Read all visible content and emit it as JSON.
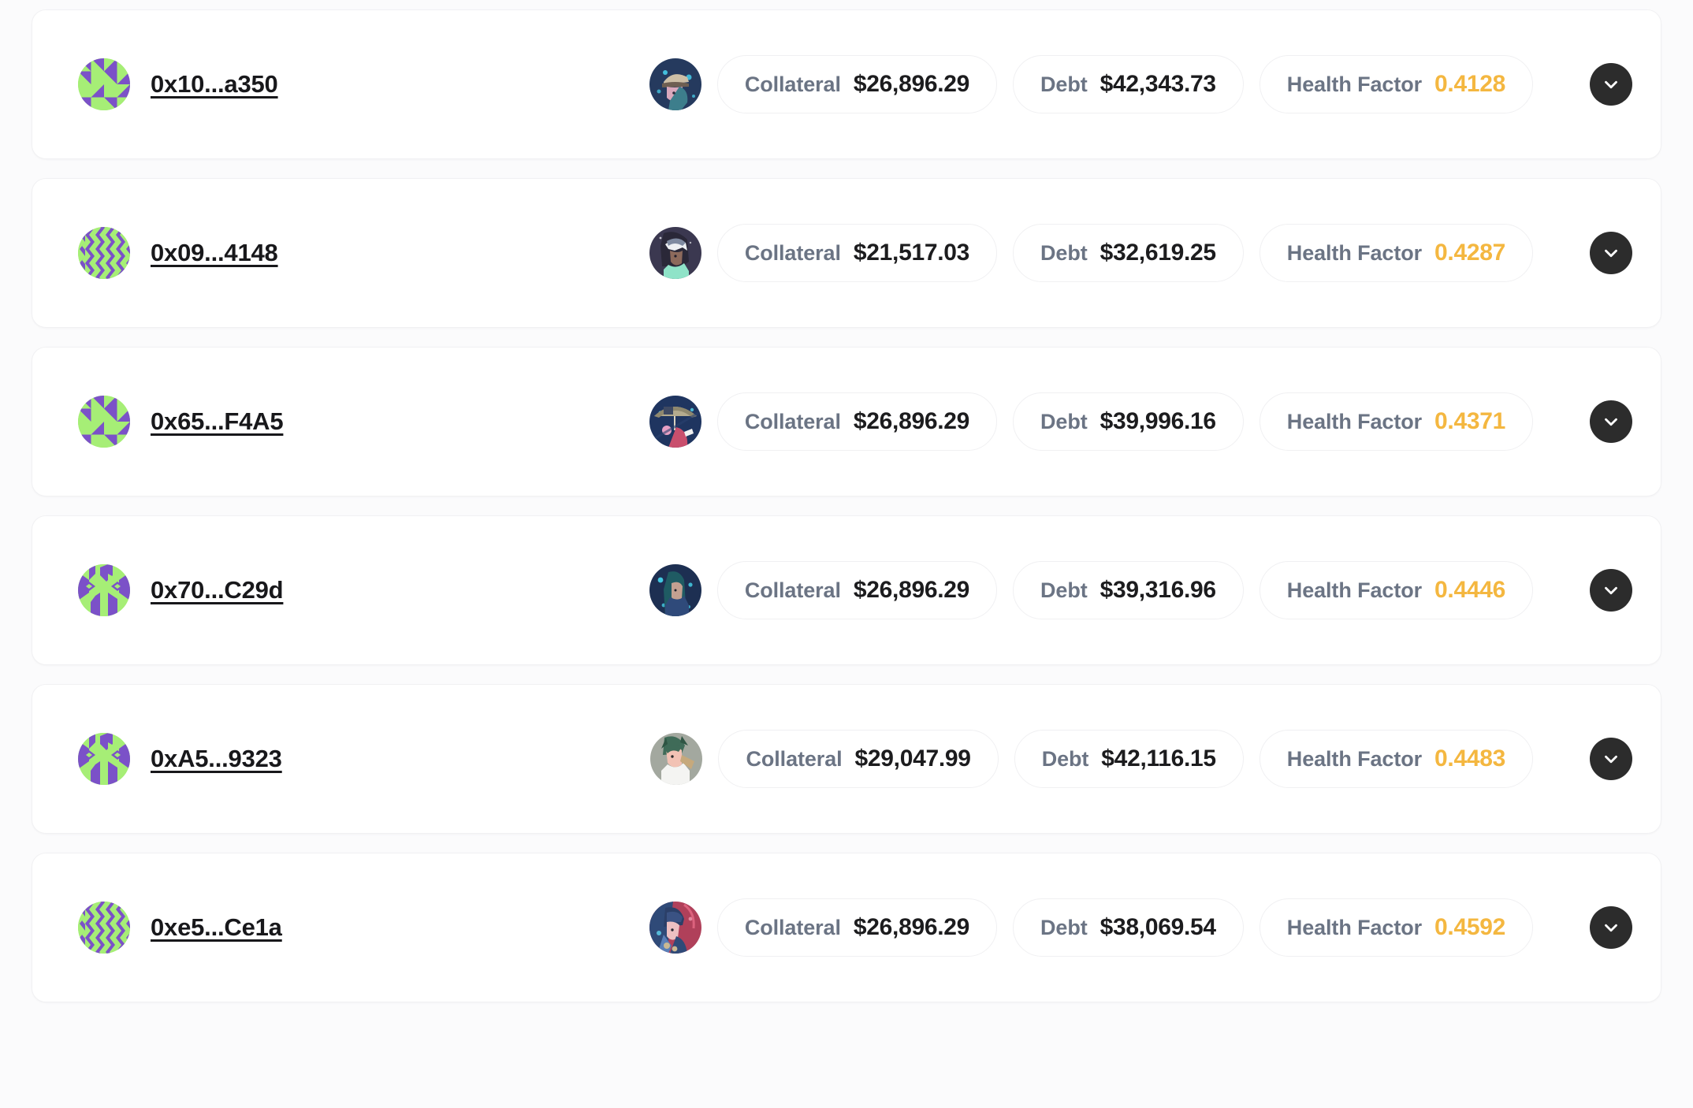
{
  "list": {
    "name": "liquidation-positions-list",
    "labels": {
      "collateral": "Collateral",
      "debt": "Debt",
      "health_factor": "Health Factor"
    },
    "colors": {
      "health_factor_value": "#f4b740",
      "metric_label": "#6b7484",
      "metric_value": "#1c1c1e",
      "expand_button_bg": "#2c2c2c",
      "card_bg": "#ffffff",
      "page_bg": "#fbfbfc",
      "identicon_purple": "#7b51c8",
      "identicon_green": "#a6ee76"
    },
    "icons": {
      "expand": "chevron-down-icon"
    },
    "rows": [
      {
        "address": "0x10...a350",
        "identicon_pattern": "triangles",
        "avatar": "anime-avatar-cap-blue",
        "collateral_label": "Collateral",
        "collateral": "$26,896.29",
        "debt_label": "Debt",
        "debt": "$42,343.73",
        "health_label": "Health Factor",
        "health_factor": "0.4128"
      },
      {
        "address": "0x09...4148",
        "identicon_pattern": "herringbone",
        "avatar": "anime-avatar-white-hair",
        "collateral_label": "Collateral",
        "collateral": "$21,517.03",
        "debt_label": "Debt",
        "debt": "$32,619.25",
        "health_label": "Health Factor",
        "health_factor": "0.4287"
      },
      {
        "address": "0x65...F4A5",
        "identicon_pattern": "triangles",
        "avatar": "anime-avatar-umbrella",
        "collateral_label": "Collateral",
        "collateral": "$26,896.29",
        "debt_label": "Debt",
        "debt": "$39,996.16",
        "health_label": "Health Factor",
        "health_factor": "0.4371"
      },
      {
        "address": "0x70...C29d",
        "identicon_pattern": "diamonds",
        "avatar": "anime-avatar-teal-night",
        "collateral_label": "Collateral",
        "collateral": "$26,896.29",
        "debt_label": "Debt",
        "debt": "$39,316.96",
        "health_label": "Health Factor",
        "health_factor": "0.4446"
      },
      {
        "address": "0xA5...9323",
        "identicon_pattern": "diamonds",
        "avatar": "anime-avatar-green-hair",
        "collateral_label": "Collateral",
        "collateral": "$29,047.99",
        "debt_label": "Debt",
        "debt": "$42,116.15",
        "health_label": "Health Factor",
        "health_factor": "0.4483"
      },
      {
        "address": "0xe5...Ce1a",
        "identicon_pattern": "herringbone",
        "avatar": "anime-avatar-red-helmet",
        "collateral_label": "Collateral",
        "collateral": "$26,896.29",
        "debt_label": "Debt",
        "debt": "$38,069.54",
        "health_label": "Health Factor",
        "health_factor": "0.4592"
      }
    ]
  }
}
